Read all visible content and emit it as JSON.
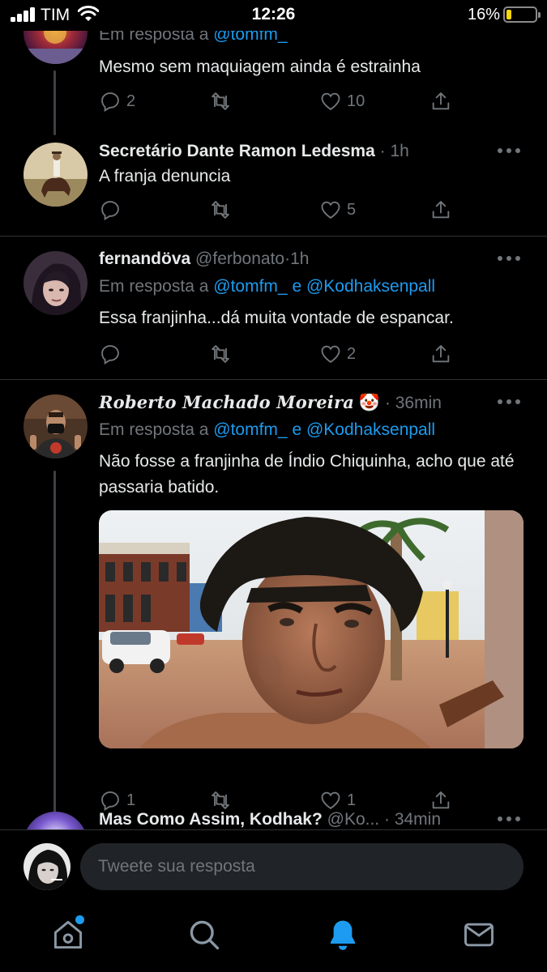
{
  "status_bar": {
    "carrier": "TIM",
    "time": "12:26",
    "battery_percent": "16%",
    "battery_level": 0.16
  },
  "tweets": [
    {
      "reply_to": {
        "prefix": "Em resposta a",
        "mentions": [
          "@tomfm_"
        ]
      },
      "text": "Mesmo sem maquiagem ainda é estrainha",
      "counts": {
        "replies": "2",
        "retweets": "",
        "likes": "10"
      }
    },
    {
      "name": "Secretário Dante Ramon Ledesma",
      "handle": "",
      "time": "1h",
      "text": "A franja denuncia",
      "counts": {
        "replies": "",
        "retweets": "",
        "likes": "5"
      }
    },
    {
      "name": "fernandöva",
      "handle": "@ferbonato",
      "time": "1h",
      "reply_to": {
        "prefix": "Em resposta a",
        "mentions": [
          "@tomfm_",
          "@Kodhaksenpall"
        ],
        "joiner": "e"
      },
      "text": "Essa franjinha...dá muita vontade de espancar.",
      "counts": {
        "replies": "",
        "retweets": "",
        "likes": "2"
      }
    },
    {
      "name": "Roberto Machado Moreira",
      "name_emoji": "🤡",
      "handle": "",
      "time": "36min",
      "reply_to": {
        "prefix": "Em resposta a",
        "mentions": [
          "@tomfm_",
          "@Kodhaksenpall"
        ],
        "joiner": "e"
      },
      "text": "Não fosse a franjinha de Índio Chiquinha, acho que até passaria batido.",
      "counts": {
        "replies": "1",
        "retweets": "",
        "likes": "1"
      }
    },
    {
      "name": "Mas Como Assim, Kodhak?",
      "handle": "@Ko...",
      "time": "34min"
    }
  ],
  "dot_separator": "·",
  "composer": {
    "placeholder": "Tweete sua resposta"
  },
  "tabs": [
    {
      "name": "home-icon"
    },
    {
      "name": "search-icon"
    },
    {
      "name": "notifications-icon",
      "active": true
    },
    {
      "name": "messages-icon"
    }
  ],
  "colors": {
    "accent": "#1d9bf0",
    "muted": "#71767b",
    "background": "#000000",
    "text": "#e7e9ea"
  }
}
